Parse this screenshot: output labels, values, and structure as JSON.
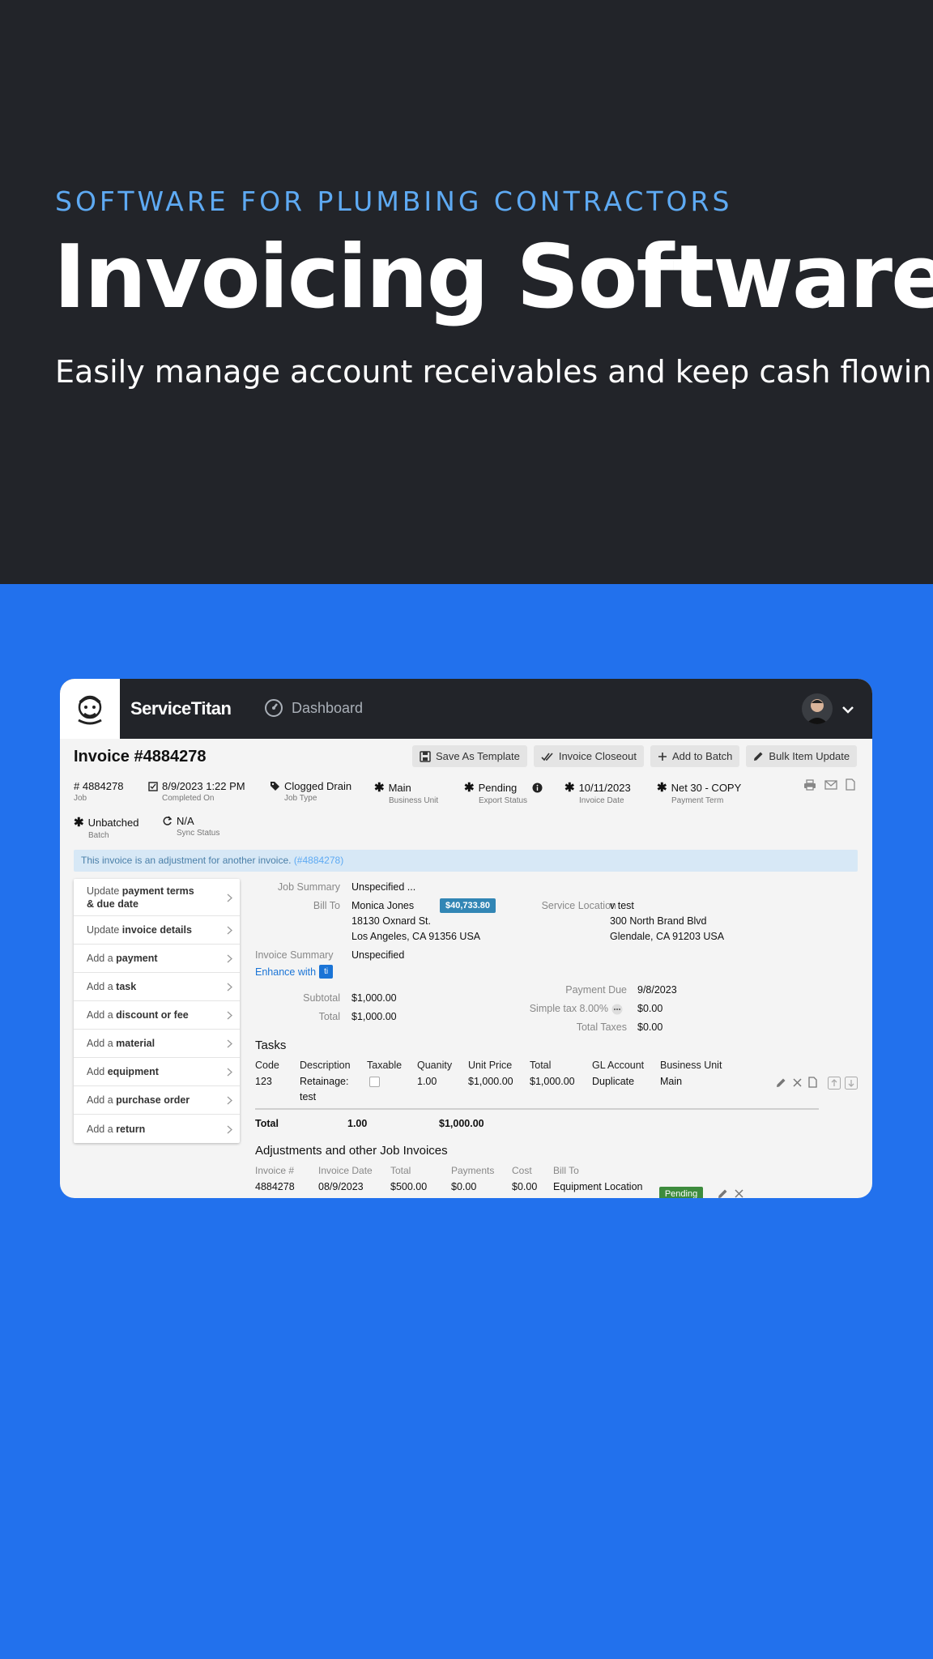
{
  "hero": {
    "eyebrow": "SOFTWARE FOR PLUMBING CONTRACTORS",
    "title": "Invoicing Software",
    "subtitle": "Easily manage account receivables and keep cash flowing"
  },
  "app": {
    "brand": "ServiceTitan",
    "nav_dashboard": "Dashboard",
    "invoice_title": "Invoice #4884278",
    "actions": {
      "save_template": "Save As Template",
      "closeout": "Invoice Closeout",
      "add_batch": "Add to Batch",
      "bulk_update": "Bulk Item Update"
    },
    "meta": {
      "job": {
        "value": "# 4884278",
        "label": "Job"
      },
      "completed": {
        "value": "8/9/2023 1:22 PM",
        "label": "Completed On"
      },
      "job_type": {
        "value": "Clogged Drain",
        "label": "Job Type"
      },
      "business_unit": {
        "value": "Main",
        "label": "Business Unit"
      },
      "export_status": {
        "value": "Pending",
        "label": "Export Status"
      },
      "invoice_date": {
        "value": "10/11/2023",
        "label": "Invoice Date"
      },
      "payment_term": {
        "value": "Net 30 - COPY",
        "label": "Payment Term"
      },
      "batch": {
        "value": "Unbatched",
        "label": "Batch"
      },
      "sync_status": {
        "value": "N/A",
        "label": "Sync Status"
      }
    },
    "banner": {
      "text": "This invoice is an adjustment for another invoice.",
      "link": "(#4884278)"
    },
    "menu": [
      {
        "pre": "Update",
        "bold": "payment terms",
        "line2": "& due date"
      },
      {
        "pre": "Update",
        "bold": "invoice details"
      },
      {
        "pre": "Add a",
        "bold": "payment"
      },
      {
        "pre": "Add a",
        "bold": "task"
      },
      {
        "pre": "Add a",
        "bold": "discount or fee"
      },
      {
        "pre": "Add a",
        "bold": "material"
      },
      {
        "pre": "Add",
        "bold": "equipment"
      },
      {
        "pre": "Add a",
        "bold": "purchase order"
      },
      {
        "pre": "Add a",
        "bold": "return"
      }
    ],
    "details": {
      "job_summary_label": "Job Summary",
      "job_summary_value": "Unspecified ...",
      "bill_to_label": "Bill To",
      "bill_to_name": "Monica Jones",
      "bill_to_street": "18130 Oxnard St.",
      "bill_to_city": "Los Angeles, CA 91356 USA",
      "balance_badge": "$40,733.80",
      "service_location_label": "Service Location",
      "service_name": "v test",
      "service_street": "300 North Brand Blvd",
      "service_city": "Glendale, CA 91203 USA",
      "invoice_summary_label": "Invoice Summary",
      "invoice_summary_value": "Unspecified",
      "enhance_label": "Enhance with",
      "enhance_badge": "ti",
      "subtotal_label": "Subtotal",
      "subtotal_value": "$1,000.00",
      "total_label": "Total",
      "total_value": "$1,000.00",
      "payment_due_label": "Payment Due",
      "payment_due_value": "9/8/2023",
      "tax_label": "Simple tax 8.00%",
      "tax_value": "$0.00",
      "total_taxes_label": "Total Taxes",
      "total_taxes_value": "$0.00"
    },
    "tasks": {
      "title": "Tasks",
      "headers": [
        "Code",
        "Description",
        "Taxable",
        "Quanity",
        "Unit Price",
        "Total",
        "GL Account",
        "Business Unit"
      ],
      "row": {
        "code": "123",
        "desc_line1": "Retainage:",
        "desc_line2": "test",
        "quantity": "1.00",
        "unit_price": "$1,000.00",
        "total": "$1,000.00",
        "gl": "Duplicate",
        "bu": "Main"
      },
      "totals": {
        "label": "Total",
        "quantity": "1.00",
        "amount": "$1,000.00"
      }
    },
    "adjustments": {
      "title": "Adjustments and other Job Invoices",
      "headers": [
        "Invoice #",
        "Invoice Date",
        "Total",
        "Payments",
        "Cost",
        "Bill To"
      ],
      "row": {
        "invoice": "4884278",
        "date": "08/9/2023",
        "total": "$500.00",
        "payments": "$0.00",
        "cost": "$0.00",
        "bill_to": "Equipment Location",
        "status": "Pending"
      }
    }
  }
}
